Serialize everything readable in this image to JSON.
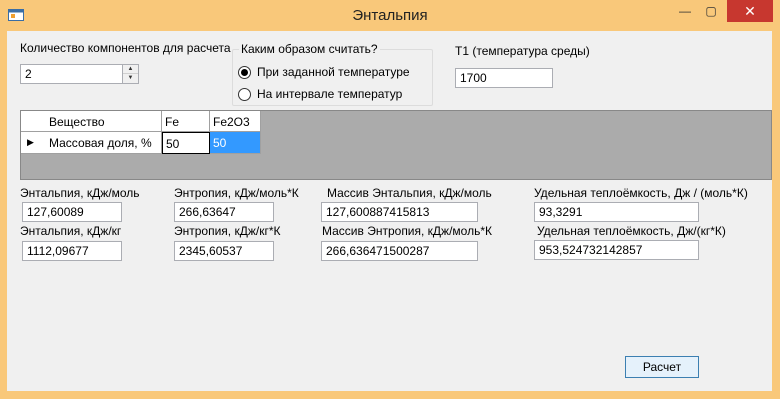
{
  "window": {
    "title": "Энтальпия",
    "minimize_glyph": "—",
    "maximize_glyph": "▢",
    "close_glyph": "✕"
  },
  "components": {
    "label": "Количество компонентов для расчета",
    "value": "2"
  },
  "method": {
    "legend": "Каким образом считать?",
    "options": [
      {
        "label": "При заданной температуре",
        "selected": true
      },
      {
        "label": "На интервале температур",
        "selected": false
      }
    ]
  },
  "temperature": {
    "label": "T1 (температура среды)",
    "value": "1700"
  },
  "grid": {
    "row_header_label": "Вещество",
    "row_label": "Массовая доля, %",
    "columns": [
      {
        "name": "Fe",
        "value": "50"
      },
      {
        "name": "Fe2O3",
        "value": "50"
      }
    ]
  },
  "results": {
    "enthalpy_mol": {
      "label": "Энтальпия, кДж/моль",
      "value": "127,60089"
    },
    "entropy_mol": {
      "label": "Энтропия, кДж/моль*К",
      "value": "266,63647"
    },
    "enthalpy_array": {
      "label": "Массив Энтальпия, кДж/моль",
      "value": "127,600887415813"
    },
    "heat_capacity_mol": {
      "label": "Удельная теплоёмкость, Дж / (моль*К)",
      "value": "93,3291"
    },
    "enthalpy_kg": {
      "label": "Энтальпия, кДж/кг",
      "value": "1112,09677"
    },
    "entropy_kg": {
      "label": "Энтропия, кДж/кг*К",
      "value": "2345,60537"
    },
    "entropy_array": {
      "label": "Массив Энтропия, кДж/моль*К",
      "value": "266,636471500287"
    },
    "heat_capacity_kg": {
      "label": "Удельная теплоёмкость, Дж/(кг*К)",
      "value": "953,524732142857"
    }
  },
  "calculate_button": {
    "label": "Расчет"
  },
  "colors": {
    "titlebar": "#f9c87a",
    "close_button": "#c7372f",
    "selected_cell": "#3399ff",
    "grid_background": "#ababab"
  }
}
